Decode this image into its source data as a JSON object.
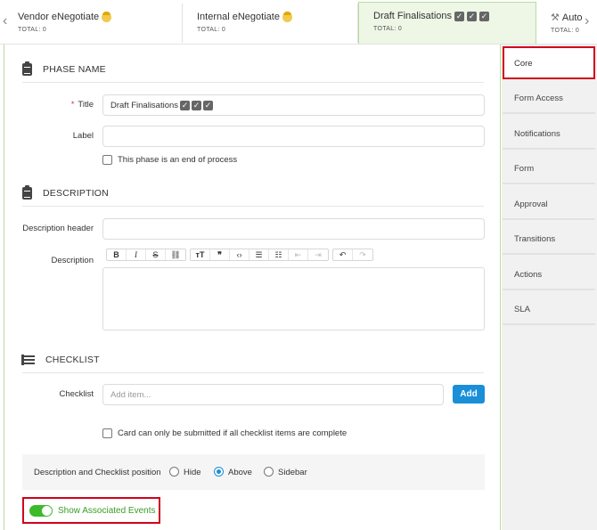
{
  "tabs": [
    {
      "name": "Vendor eNegotiate",
      "total": "TOTAL: 0",
      "icon": "worker-icon"
    },
    {
      "name": "Internal eNegotiate",
      "total": "TOTAL: 0",
      "icon": "worker-icon"
    },
    {
      "name": "Draft Finalisations",
      "total": "TOTAL: 0",
      "icon": "checkbox-icons"
    },
    {
      "name": "Auto",
      "total": "TOTAL: 0",
      "icon": "tools-icon"
    }
  ],
  "sections": {
    "phase_name": "PHASE NAME",
    "description": "DESCRIPTION",
    "checklist": "CHECKLIST"
  },
  "fields": {
    "title_label": "Title",
    "title_value": "Draft Finalisations",
    "label_label": "Label",
    "label_value": "",
    "end_process": "This phase is an end of process",
    "desc_header_label": "Description header",
    "desc_label": "Description",
    "checklist_label": "Checklist",
    "checklist_placeholder": "Add item...",
    "add_button": "Add",
    "checklist_required": "Card can only be submitted if all checklist items are complete",
    "position_label": "Description and Checklist position",
    "position_options": [
      "Hide",
      "Above",
      "Sidebar"
    ],
    "position_selected": "Above",
    "show_events": "Show Associated Events"
  },
  "sidebar": {
    "items": [
      "Core",
      "Form Access",
      "Notifications",
      "Form",
      "Approval",
      "Transitions",
      "Actions",
      "SLA"
    ],
    "active": "Core"
  },
  "colors": {
    "active_tab_bg": "#eef6e6",
    "accent_blue": "#1a8fd8",
    "toggle_green": "#3cba2a",
    "highlight_red": "#d0021b"
  }
}
